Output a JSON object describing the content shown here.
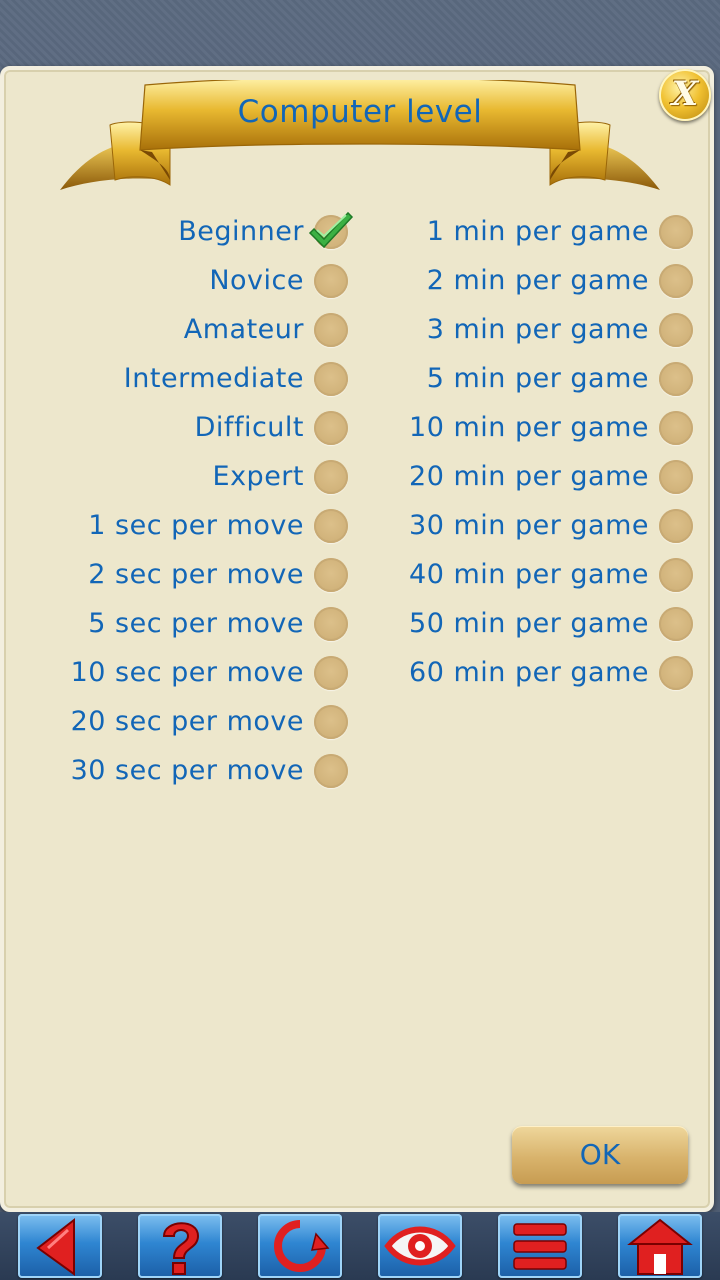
{
  "dialog": {
    "title": "Computer level",
    "close_icon": "close-x-icon",
    "ok_label": "OK"
  },
  "levels_left": [
    {
      "label": "Beginner",
      "checked": true
    },
    {
      "label": "Novice",
      "checked": false
    },
    {
      "label": "Amateur",
      "checked": false
    },
    {
      "label": "Intermediate",
      "checked": false
    },
    {
      "label": "Difficult",
      "checked": false
    },
    {
      "label": "Expert",
      "checked": false
    },
    {
      "label": "1 sec per move",
      "checked": false
    },
    {
      "label": "2 sec per move",
      "checked": false
    },
    {
      "label": "5 sec per move",
      "checked": false
    },
    {
      "label": "10 sec per move",
      "checked": false
    },
    {
      "label": "20 sec per move",
      "checked": false
    },
    {
      "label": "30 sec per move",
      "checked": false
    }
  ],
  "levels_right": [
    {
      "label": "1 min per game",
      "checked": false
    },
    {
      "label": "2 min per game",
      "checked": false
    },
    {
      "label": "3 min per game",
      "checked": false
    },
    {
      "label": "5 min per game",
      "checked": false
    },
    {
      "label": "10 min per game",
      "checked": false
    },
    {
      "label": "20 min per game",
      "checked": false
    },
    {
      "label": "30 min per game",
      "checked": false
    },
    {
      "label": "40 min per game",
      "checked": false
    },
    {
      "label": "50 min per game",
      "checked": false
    },
    {
      "label": "60 min per game",
      "checked": false
    }
  ],
  "toolbar": {
    "buttons": [
      {
        "icon": "back-arrow-icon"
      },
      {
        "icon": "help-question-icon"
      },
      {
        "icon": "rotate-board-icon"
      },
      {
        "icon": "eye-icon"
      },
      {
        "icon": "menu-icon"
      },
      {
        "icon": "home-icon"
      }
    ]
  },
  "colors": {
    "text_blue": "#1266b7",
    "dialog_bg": "#ede7cc",
    "radio_fill": "#d2b47c",
    "check_green": "#3cb043"
  }
}
